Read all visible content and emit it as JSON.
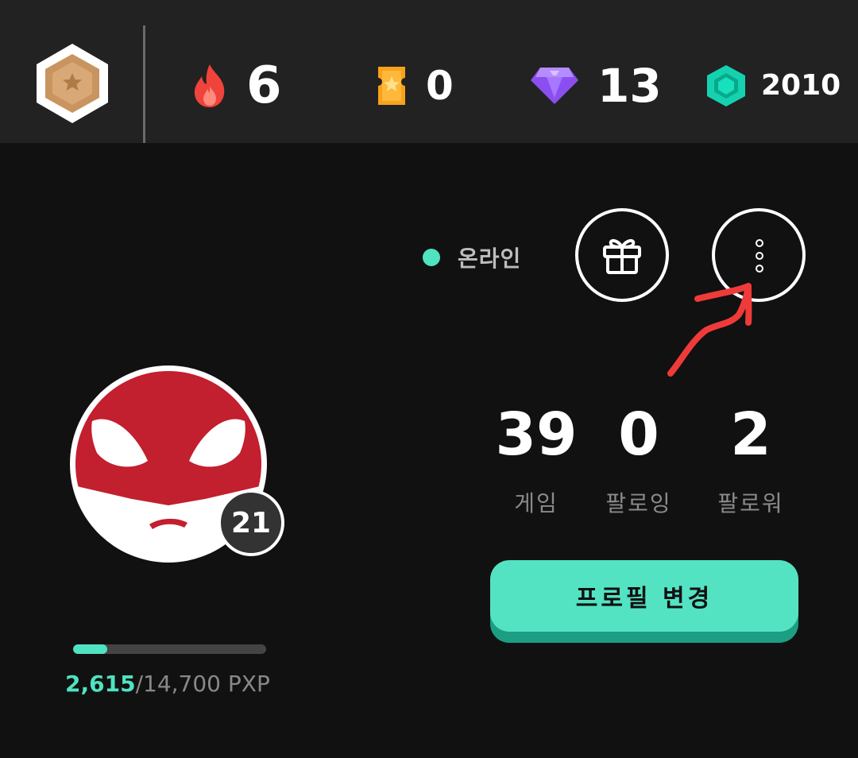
{
  "header": {
    "rank_icon": "bronze-hexagon-star-badge",
    "stats": {
      "streak": {
        "icon": "fire-icon",
        "value": "6",
        "color": "#f0433b"
      },
      "tickets": {
        "icon": "ticket-star-icon",
        "value": "0",
        "color": "#f7a21b"
      },
      "gems": {
        "icon": "purple-gem-icon",
        "value": "13",
        "color": "#9b5cf6"
      },
      "coins": {
        "icon": "teal-hexagon-coin-icon",
        "value": "2010",
        "color": "#14d2b0"
      }
    }
  },
  "status": {
    "label": "온라인",
    "color": "#4fe3c1"
  },
  "actions": {
    "gift_icon": "gift-icon",
    "more_icon": "more-vertical-icon"
  },
  "profile": {
    "avatar": "red-masked-face-avatar",
    "level": "21",
    "xp": {
      "current": "2,615",
      "total": "/14,700 PXP",
      "progress": 0.178
    }
  },
  "social": {
    "games": {
      "value": "39",
      "label": "게임"
    },
    "following": {
      "value": "0",
      "label": "팔로잉"
    },
    "followers": {
      "value": "2",
      "label": "팔로워"
    }
  },
  "edit_button": {
    "label": "프로필 변경",
    "color": "#53e3c3"
  },
  "annotation": {
    "type": "red-hand-drawn-arrow",
    "color": "#f03a3a"
  }
}
